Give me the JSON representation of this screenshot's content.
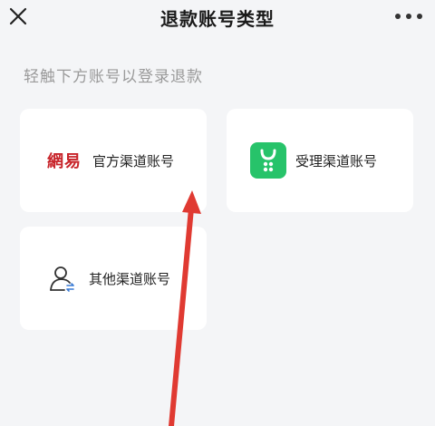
{
  "header": {
    "title": "退款账号类型",
    "close_icon": "close-icon",
    "more_icon": "more-dots-icon"
  },
  "hint": "轻触下方账号以登录退款",
  "cards": {
    "official": {
      "brand": "網易",
      "label": "官方渠道账号"
    },
    "accept": {
      "icon": "green-shopping-bag-icon",
      "label": "受理渠道账号"
    },
    "other": {
      "icon": "user-swap-icon",
      "label": "其他渠道账号"
    }
  },
  "colors": {
    "background": "#f4f5f7",
    "card": "#ffffff",
    "brand_red": "#c8242a",
    "app_green": "#27c36a",
    "arrow_red": "#e03a32"
  }
}
